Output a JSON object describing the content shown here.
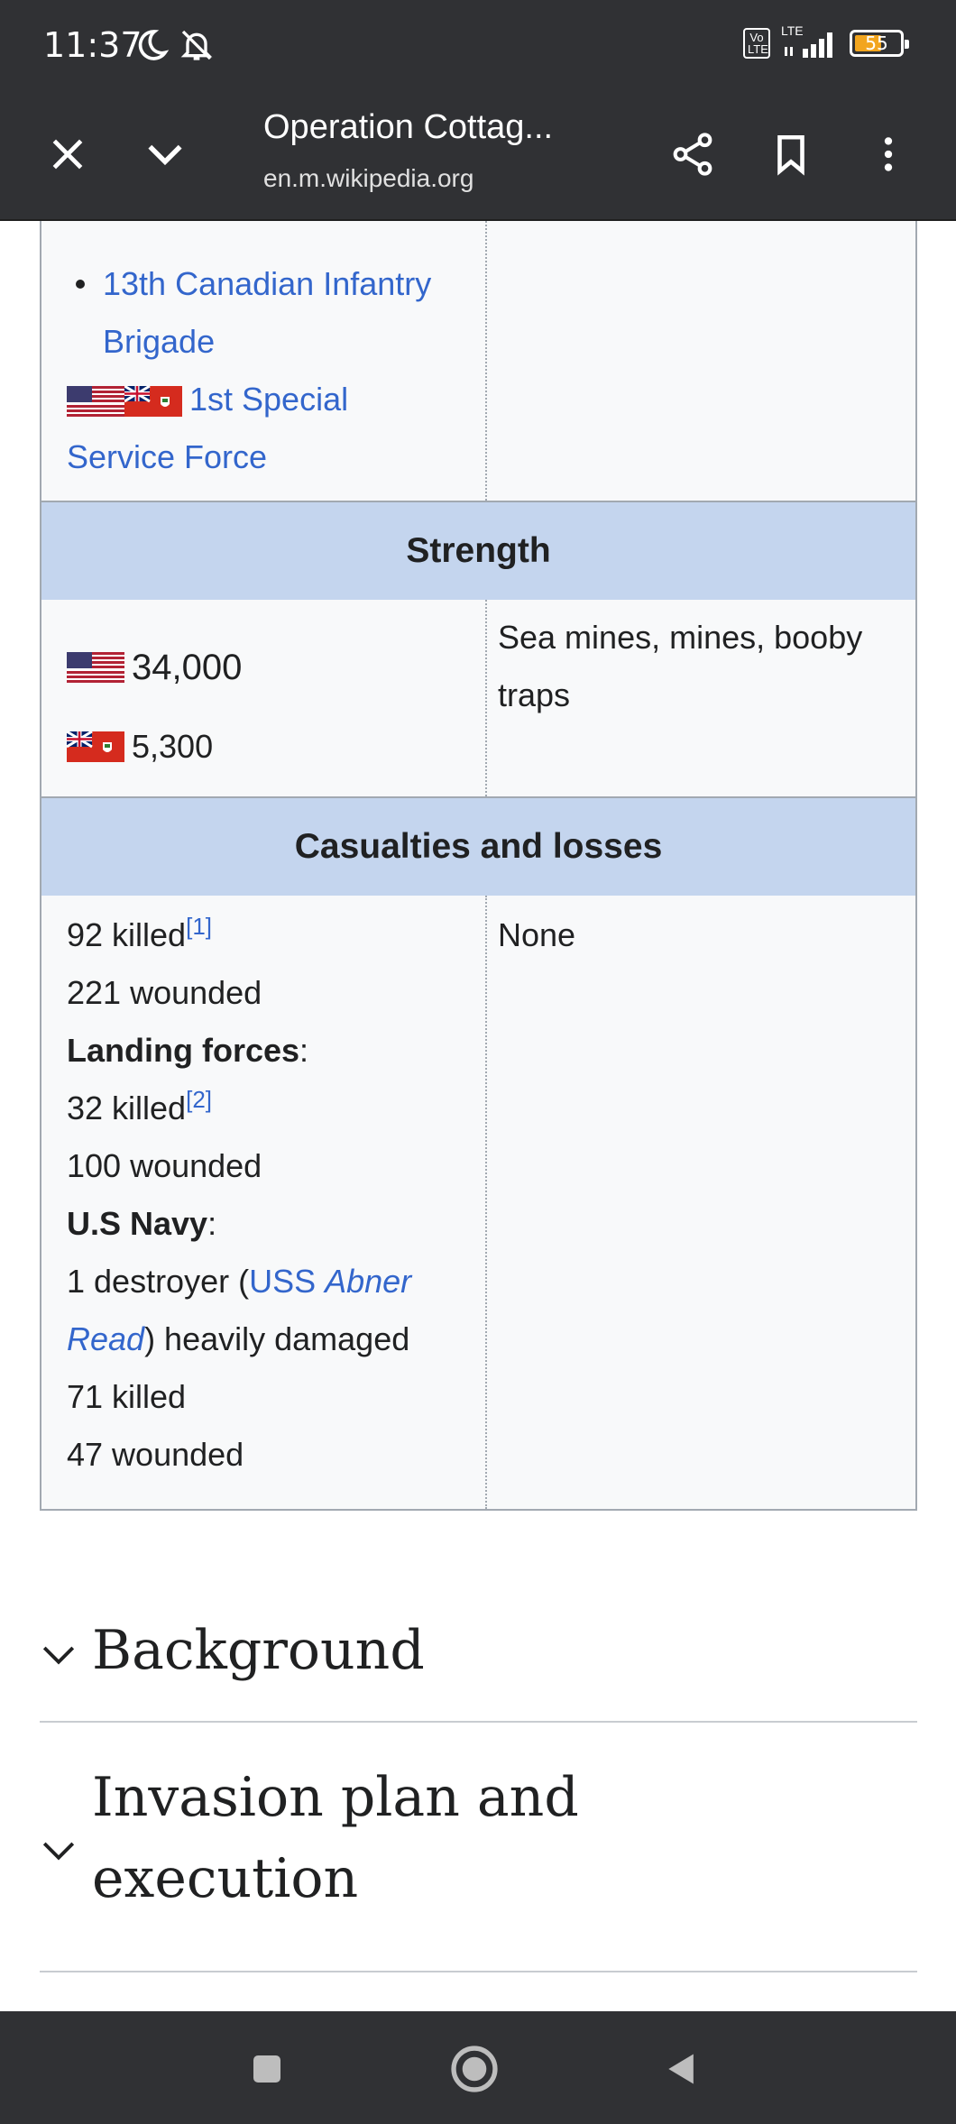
{
  "status_bar": {
    "time": "11:37",
    "network": "LTE",
    "volte": "Vo LTE",
    "battery": "55",
    "battery_fraction": 0.55
  },
  "toolbar": {
    "title": "Operation Cottag...",
    "url": "en.m.wikipedia.org",
    "icons": [
      "close-icon",
      "chevron-down-icon",
      "share-icon",
      "bookmark-icon",
      "more-vert-icon"
    ]
  },
  "infobox": {
    "units": {
      "list_item": "13th Canadian Infantry Brigade",
      "force_line1": "1st Special",
      "force_line2": "Service Force"
    },
    "strength": {
      "header": "Strength",
      "us": "34,000",
      "canada": "5,300",
      "japan": "Sea mines, mines, booby traps"
    },
    "casualties": {
      "header": "Casualties and losses",
      "line1": "92 killed",
      "ref1": "[1]",
      "line2": "221 wounded",
      "landing_label": "Landing forces",
      "line3": "32 killed",
      "ref2": "[2]",
      "line4": "100 wounded",
      "navy_label": "U.S Navy",
      "destroyer_prefix": "1 destroyer (",
      "ship_link_prefix": "USS ",
      "ship_link_name1": "Abner",
      "ship_link_name2": "Read",
      "destroyer_suffix": ") heavily damaged",
      "line5": "71 killed",
      "line6": "47 wounded",
      "japan": "None"
    }
  },
  "sections": [
    {
      "title": "Background"
    },
    {
      "title_line1": "Invasion plan and",
      "title_line2": "execution"
    }
  ],
  "colors": {
    "chrome": "#303134",
    "link": "#3366cc",
    "infobox_header": "#c4d5ee",
    "infobox_bg": "#f8f9fa"
  }
}
